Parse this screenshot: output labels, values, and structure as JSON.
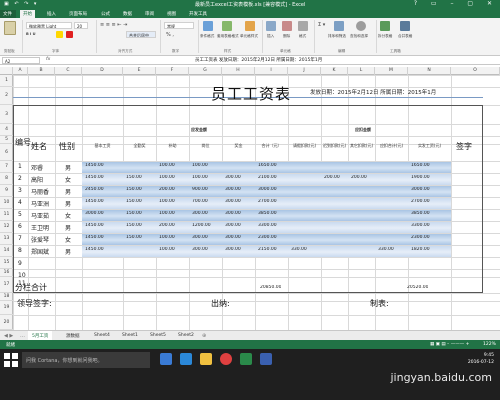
{
  "window": {
    "quick_access": "▣ ↶ ↷ ▾",
    "title": "最新员工excel工资表模板.xls [兼容模式] - Excel",
    "controls": "? ▭ – ▢ ✕"
  },
  "ribbon": {
    "tabs": [
      "文件",
      "开始",
      "插入",
      "页面布局",
      "公式",
      "数据",
      "审阅",
      "视图",
      "开发工具"
    ],
    "active_tab": 1,
    "font_name": "微软雅黑 Light",
    "font_size": "20",
    "number_format": "常规",
    "percent": "% ,",
    "buttons": [
      "条件格式",
      "套用表格格式",
      "单元格样式",
      "插入",
      "删除",
      "格式",
      "排序和筛选",
      "查找和选择",
      "拆分表格",
      "合并表格"
    ],
    "merge_button": "合并后居中",
    "groups": [
      "剪贴板",
      "字体",
      "对齐方式",
      "数字",
      "样式",
      "单元格",
      "编辑",
      "工具箱"
    ],
    "colors": {
      "green": "#217346",
      "band": "#a9c4e4"
    }
  },
  "formula_bar": {
    "name_box": "A2",
    "fx": "fx",
    "content": "员工工资表    发放日期：2015年2月12日  所属日期：2015年1月"
  },
  "columns": [
    "A",
    "B",
    "C",
    "D",
    "E",
    "F",
    "G",
    "H",
    "I",
    "J",
    "K",
    "L",
    "M",
    "N",
    "O"
  ],
  "rows": [
    "1",
    "2",
    "3",
    "4",
    "5",
    "6",
    "7",
    "8",
    "9",
    "10",
    "11",
    "12",
    "13",
    "14",
    "15",
    "16",
    "17",
    "18",
    "19",
    "20"
  ],
  "sheet": {
    "title": "员工工资表",
    "subtitle": "发放日期：2015年2月12日  所属日期：2015年1月",
    "group_pay": "应发金额",
    "group_deduct": "应扣金额",
    "col_no": "编号",
    "col_name": "姓名",
    "col_sex": "性别",
    "sub_headers": [
      "基本工资",
      "全勤奖",
      "补助",
      "岗位",
      "奖金",
      "合计（元）",
      "请假扣款(元)",
      "迟到扣款(元)",
      "其它扣款(元)",
      "应扣合计(元)",
      "实发工资(元)"
    ],
    "col_sign": "签字",
    "employees": [
      {
        "no": "1",
        "name": "邓睿",
        "sex": "男",
        "vals": [
          "1450.00",
          "",
          "100.00",
          "100.00",
          "",
          "1650.00",
          "",
          "",
          "",
          "",
          "1650.00"
        ]
      },
      {
        "no": "2",
        "name": "高阳",
        "sex": "女",
        "vals": [
          "1450.00",
          "150.00",
          "100.00",
          "100.00",
          "300.00",
          "2100.00",
          "",
          "200.00",
          "200.00",
          "",
          "1900.00"
        ]
      },
      {
        "no": "3",
        "name": "马丽香",
        "sex": "男",
        "vals": [
          "2450.00",
          "150.00",
          "200.00",
          "900.00",
          "300.00",
          "3000.00",
          "",
          "",
          "",
          "",
          "3000.00"
        ]
      },
      {
        "no": "4",
        "name": "马亚洲",
        "sex": "男",
        "vals": [
          "1450.00",
          "150.00",
          "100.00",
          "700.00",
          "300.00",
          "2700.00",
          "",
          "",
          "",
          "",
          "2700.00"
        ]
      },
      {
        "no": "5",
        "name": "马亚茹",
        "sex": "女",
        "vals": [
          "3000.00",
          "150.00",
          "100.00",
          "300.00",
          "300.00",
          "3850.00",
          "",
          "",
          "",
          "",
          "3850.00"
        ]
      },
      {
        "no": "6",
        "name": "王卫明",
        "sex": "男",
        "vals": [
          "1450.00",
          "150.00",
          "200.00",
          "1200.00",
          "300.00",
          "3300.00",
          "",
          "",
          "",
          "",
          "3300.00"
        ]
      },
      {
        "no": "7",
        "name": "张爱琴",
        "sex": "女",
        "vals": [
          "1450.00",
          "150.00",
          "100.00",
          "300.00",
          "300.00",
          "2300.00",
          "",
          "",
          "",
          "",
          "2300.00"
        ]
      },
      {
        "no": "8",
        "name": "郑国斌",
        "sex": "男",
        "vals": [
          "1450.00",
          "",
          "100.00",
          "300.00",
          "300.00",
          "2150.00",
          "330.00",
          "",
          "",
          "330.00",
          "1820.00"
        ]
      }
    ],
    "blank_rows": [
      "9",
      "10",
      "11"
    ],
    "total_label": "分栏合计",
    "total_sum": "20850.00",
    "total_net": "20520.00",
    "leader_sign": "领导签字:",
    "cashier": "出纳:",
    "maker": "制表:"
  },
  "sheet_tabs": [
    "5月工资",
    "源数据",
    "Sheet4",
    "Sheet1",
    "Sheet5",
    "Sheet2"
  ],
  "active_sheet": 0,
  "status": {
    "ready": "就绪",
    "zoom": "122%"
  },
  "taskbar": {
    "search": "问我 Cortana，你想到就问我吧。",
    "time": "9:45",
    "date": "2016-07-12"
  },
  "watermark": "jingyan.baidu.com"
}
